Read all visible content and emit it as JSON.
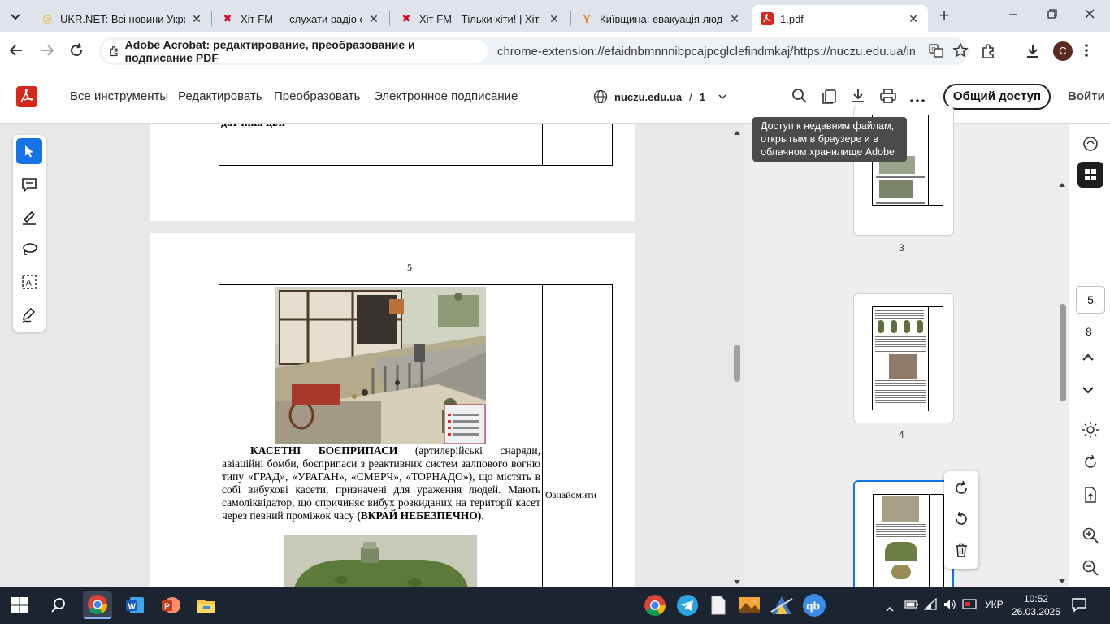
{
  "browser": {
    "tabs": [
      {
        "title": "UKR.NET: Всі новини Україн",
        "icon": "ukrnet-favicon"
      },
      {
        "title": "Хіт FM — слухати радіо онл",
        "icon": "hitfm-favicon"
      },
      {
        "title": "Хіт FM - Тільки хіти! | Хіт FM",
        "icon": "hitfm-favicon"
      },
      {
        "title": "Київщина: евакуація людей",
        "icon": "news-favicon"
      },
      {
        "title": "1.pdf",
        "icon": "acrobat-favicon"
      }
    ],
    "extension_chip": "Adobe Acrobat: редактирование, преобразование и подписание PDF",
    "url": "chrome-extension://efaidnbmnnnibpcajpcglclefindmkaj/https://nuczu.edu.ua/images/to...",
    "profile_initial": "C"
  },
  "acrobat": {
    "menu": [
      "Все инструменты",
      "Редактировать",
      "Преобразовать",
      "Электронное подписание"
    ],
    "domain": "nuczu.edu.ua",
    "separator": "/",
    "page_indicator": "1",
    "share_button": "Общий доступ",
    "signin_button": "Войти",
    "tooltip": "Доступ к недавним файлам, открытым в браузере и в облачном хранилище Adobe"
  },
  "document": {
    "prev_page_fragment": "датчика цілі",
    "page_number": "5",
    "cluster_title": "КАСЕТНІ БОЄПРИПАСИ",
    "cluster_text": "(артилерійські снаряди, авіаційні бомби, боєприпаси з реактивних систем залпового вогню типу «ГРАД», «УРАГАН», «СМЕРЧ», «ТОРНАДО»), що містять в собі вибухові касети, призначені для ураження людей. Мають самоліквідатор, що спричиняє вибух розкиданих на території касет через певний проміжок часу",
    "cluster_warning": "(ВКРАЙ НЕБЕЗПЕЧНО).",
    "right_column": "Ознайомити"
  },
  "thumbnails": {
    "labels": [
      "3",
      "4"
    ],
    "current_page": "5",
    "total_pages": "8"
  },
  "taskbar": {
    "language": "УКР",
    "time": "10:52",
    "date": "26.03.2025"
  },
  "colors": {
    "acrobat_red": "#d7261c",
    "accent_blue": "#1473e6",
    "taskbar_bg": "#1c2431"
  }
}
